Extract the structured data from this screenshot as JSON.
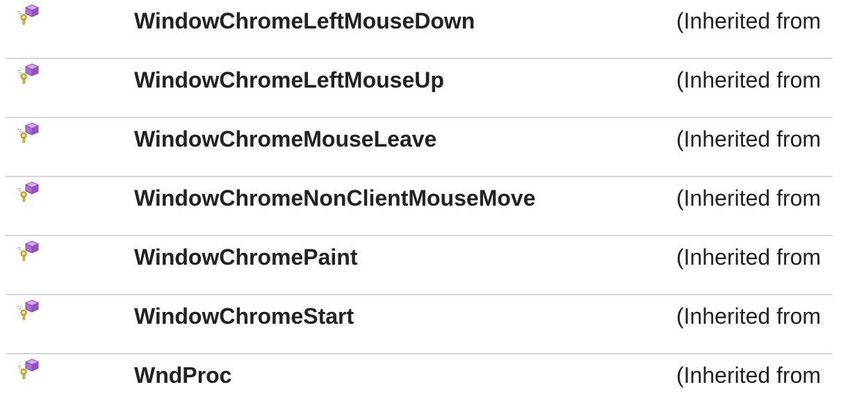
{
  "members": [
    {
      "icon": "protected-method-icon",
      "name": "WindowChromeLeftMouseDown",
      "description": "(Inherited from"
    },
    {
      "icon": "protected-method-icon",
      "name": "WindowChromeLeftMouseUp",
      "description": "(Inherited from"
    },
    {
      "icon": "protected-method-icon",
      "name": "WindowChromeMouseLeave",
      "description": "(Inherited from"
    },
    {
      "icon": "protected-method-icon",
      "name": "WindowChromeNonClientMouseMove",
      "description": "(Inherited from"
    },
    {
      "icon": "protected-method-icon",
      "name": "WindowChromePaint",
      "description": "(Inherited from"
    },
    {
      "icon": "protected-method-icon",
      "name": "WindowChromeStart",
      "description": "(Inherited from"
    },
    {
      "icon": "protected-method-icon",
      "name": "WndProc",
      "description": "(Inherited from"
    }
  ],
  "colors": {
    "icon_purple": "#b070d0",
    "icon_key": "#c8a020",
    "divider": "#d6d6d6",
    "text": "#222222"
  }
}
